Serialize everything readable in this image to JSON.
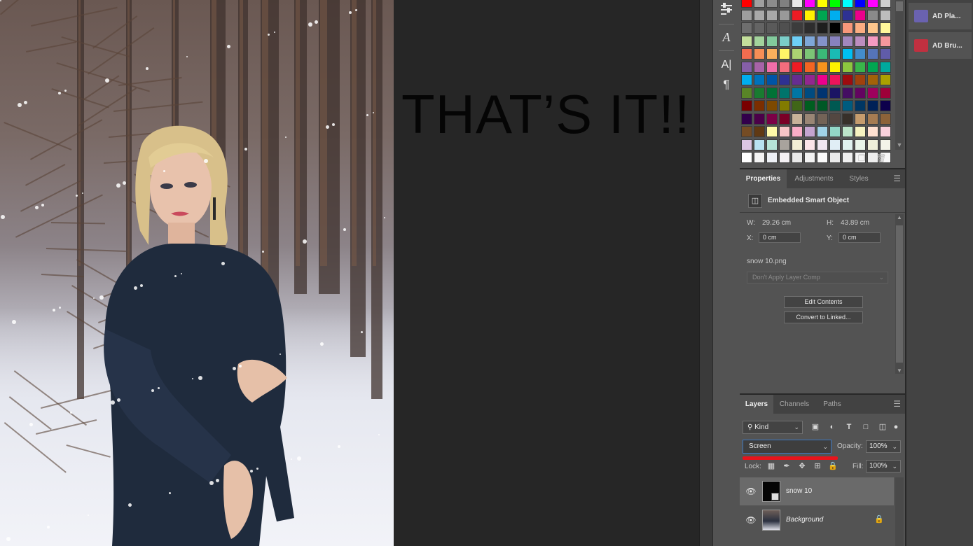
{
  "canvas": {
    "overlay_text": "THAT’S IT!!"
  },
  "toolstrip": {
    "icons": [
      "sliders-icon",
      "glyph-a-icon",
      "character-icon",
      "paragraph-icon"
    ],
    "glyph_a": "A",
    "char_a": "A|",
    "para": "¶"
  },
  "swatches": {
    "rows": [
      [
        "#ff0000",
        "#a0a0a0",
        "#8c8c8c",
        "#808080",
        "#e8e8e8",
        "#ff00ff",
        "#ffff00",
        "#00ff00",
        "#00ffff",
        "#0000ff",
        "#ff00ff",
        "#cfcfcf"
      ],
      [
        "#9e9e9e",
        "#a9a9a9",
        "#a8a8a8",
        "#999999",
        "#ed1c24",
        "#fff200",
        "#00a651",
        "#00aeef",
        "#2e3192",
        "#ec008c",
        "#8a8a8a",
        "#bdbdbd"
      ],
      [
        "#6e6e6e",
        "#646464",
        "#5a5a5a",
        "#505050",
        "#3c3c3c",
        "#2d2d2d",
        "#1e1e1e",
        "#000000",
        "#f7977a",
        "#fbad82",
        "#fdc68c",
        "#fff79a"
      ],
      [
        "#c4df9b",
        "#a3d39c",
        "#82ca9c",
        "#7bcdc8",
        "#6ecff6",
        "#7ea7d8",
        "#8493ca",
        "#8882be",
        "#a187be",
        "#bc8dbf",
        "#f49ac2",
        "#f6989d"
      ],
      [
        "#f26c4f",
        "#f68e56",
        "#fbaf5c",
        "#fff467",
        "#acd372",
        "#7cc576",
        "#3bb878",
        "#1abbb4",
        "#00bff3",
        "#438ccb",
        "#5574b9",
        "#605ca9"
      ],
      [
        "#855fa8",
        "#a763a8",
        "#f06ea9",
        "#f26d7d",
        "#ed1c24",
        "#f26522",
        "#f7941d",
        "#fff200",
        "#8dc63f",
        "#39b54a",
        "#00a651",
        "#00a99d"
      ],
      [
        "#00aeef",
        "#0072bc",
        "#0054a6",
        "#2e3192",
        "#662d91",
        "#92278f",
        "#ec008c",
        "#ed145b",
        "#9e0b0f",
        "#a0410d",
        "#a36209",
        "#aba000"
      ],
      [
        "#598527",
        "#197b30",
        "#007236",
        "#00746b",
        "#0076a3",
        "#004b80",
        "#003471",
        "#1b1464",
        "#440e62",
        "#630460",
        "#9e005d",
        "#9e0039"
      ],
      [
        "#790000",
        "#7b2e00",
        "#7d4900",
        "#827b00",
        "#406618",
        "#005e20",
        "#005826",
        "#005952",
        "#005b7f",
        "#003663",
        "#002157",
        "#0d004c"
      ],
      [
        "#32004b",
        "#4b0049",
        "#7b0046",
        "#7a0026",
        "#c7b299",
        "#998675",
        "#736357",
        "#534741",
        "#37302a",
        "#c69c6d",
        "#a67c52",
        "#8c6239"
      ],
      [
        "#754c24",
        "#603913",
        "#fef9a8",
        "#f7c5c7",
        "#f9adc7",
        "#c4a4cf",
        "#a0d2e7",
        "#93d7c7",
        "#bce4c9",
        "#f6f2c0",
        "#ffe0d0",
        "#f9d0dc"
      ],
      [
        "#dcc5e2",
        "#b9e2f1",
        "#b6e4d8",
        "#a8a39d",
        "#f2eed5",
        "#fbe4e8",
        "#f0e6f0",
        "#e0eef6",
        "#e0f2ef",
        "#e9f5e9",
        "#efefd9",
        "#f4f4e8"
      ],
      [
        "#ffffff",
        "#f4f4f4",
        "#eef1f6",
        "#f3f0f3",
        "#e8e8e8",
        "#f2f2f2",
        "#fafafa",
        "#eaeaea",
        "#f0f0f0",
        "#f5f5f5",
        "#ededed",
        "#f8f8f8"
      ]
    ],
    "new_swatch_icon": "new-swatch-icon",
    "trash_icon": "trash-icon"
  },
  "dock": {
    "items": [
      {
        "label": "AD Pla...",
        "icon": "plugin-icon",
        "color": "#6a62b0"
      },
      {
        "label": "AD Bru...",
        "icon": "brush-plugin-icon",
        "color": "#c03040"
      }
    ]
  },
  "properties": {
    "tabs": [
      "Properties",
      "Adjustments",
      "Styles"
    ],
    "title": "Embedded Smart Object",
    "w_label": "W:",
    "w_value": "29.26 cm",
    "h_label": "H:",
    "h_value": "43.89 cm",
    "x_label": "X:",
    "x_value": "0 cm",
    "y_label": "Y:",
    "y_value": "0 cm",
    "filename": "snow 10.png",
    "layer_comp": "Don't Apply Layer Comp",
    "edit_button": "Edit Contents",
    "convert_button": "Convert to Linked..."
  },
  "layers": {
    "tabs": [
      "Layers",
      "Channels",
      "Paths"
    ],
    "kind": "Kind",
    "blend_mode": "Screen",
    "opacity_label": "Opacity:",
    "opacity_value": "100%",
    "lock_label": "Lock:",
    "fill_label": "Fill:",
    "fill_value": "100%",
    "items": [
      {
        "name": "snow 10",
        "selected": true
      },
      {
        "name": "Background",
        "selected": false,
        "locked": true
      }
    ]
  }
}
